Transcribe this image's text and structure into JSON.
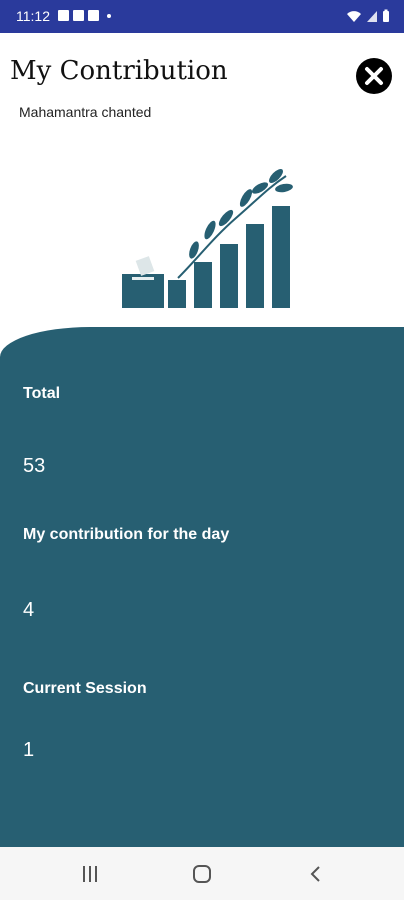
{
  "status_bar": {
    "time": "11:12",
    "left_icons": [
      "image-icon",
      "cloud-icon",
      "app-icon",
      "dot-icon"
    ],
    "right_icons": [
      "wifi-icon",
      "signal-icon",
      "battery-icon"
    ]
  },
  "header": {
    "title": "My Contribution",
    "subtitle": "Mahamantra chanted",
    "close_icon": "close-icon"
  },
  "stats": {
    "total": {
      "label": "Total",
      "value": "53"
    },
    "today": {
      "label": "My contribution for the day",
      "value": "4"
    },
    "session": {
      "label": "Current Session",
      "value": "1"
    }
  },
  "nav_bar": {
    "buttons": [
      "recents-icon",
      "home-icon",
      "back-icon"
    ]
  },
  "colors": {
    "status_bar": "#2a3a9c",
    "panel": "#275f72",
    "text_light": "#ffffff"
  }
}
